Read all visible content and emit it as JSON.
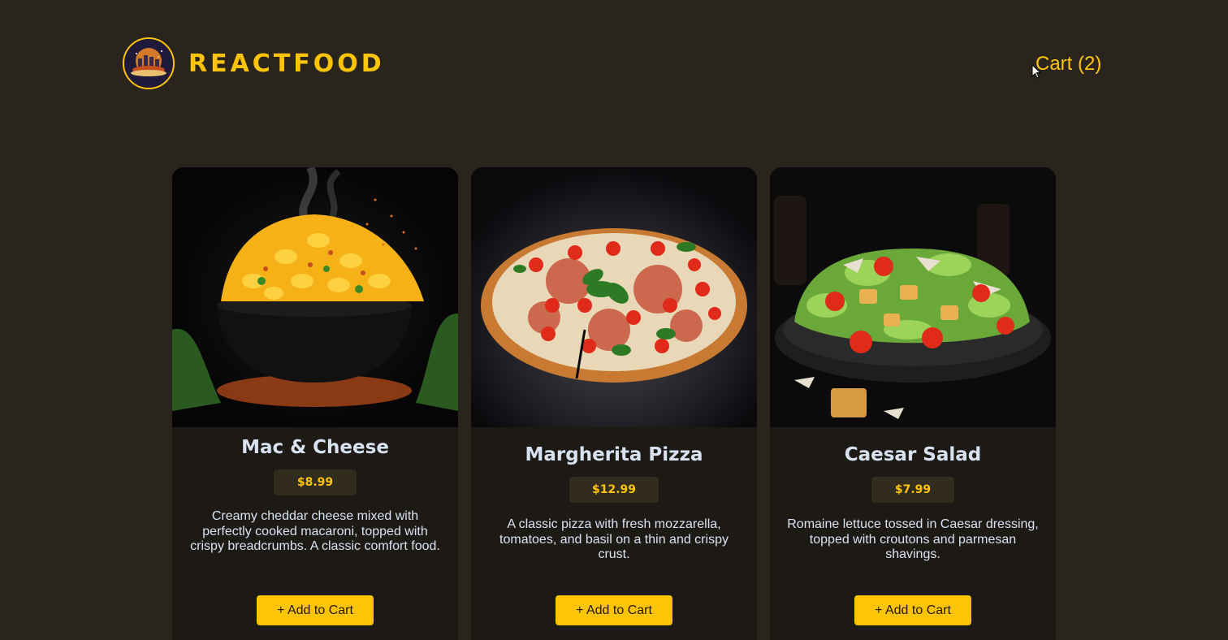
{
  "header": {
    "brand": "REACTFOOD",
    "cart_label": "Cart (2)"
  },
  "meals": [
    {
      "name": "Mac & Cheese",
      "price": "$8.99",
      "description": "Creamy cheddar cheese mixed with perfectly cooked macaroni, topped with crispy breadcrumbs. A classic comfort food.",
      "button": "+ Add to Cart"
    },
    {
      "name": "Margherita Pizza",
      "price": "$12.99",
      "description": "A classic pizza with fresh mozzarella, tomatoes, and basil on a thin and crispy crust.",
      "button": "+ Add to Cart"
    },
    {
      "name": "Caesar Salad",
      "price": "$7.99",
      "description": "Romaine lettuce tossed in Caesar dressing, topped with croutons and parmesan shavings.",
      "button": "+ Add to Cart"
    }
  ],
  "colors": {
    "background": "#29251d",
    "card": "#1d1a16",
    "accent": "#ffc404",
    "text": "#d9e2f1",
    "price_badge": "#312c1d"
  },
  "icons": {
    "logo": "restaurant-logo-icon",
    "cursor": "mouse-pointer-icon"
  }
}
